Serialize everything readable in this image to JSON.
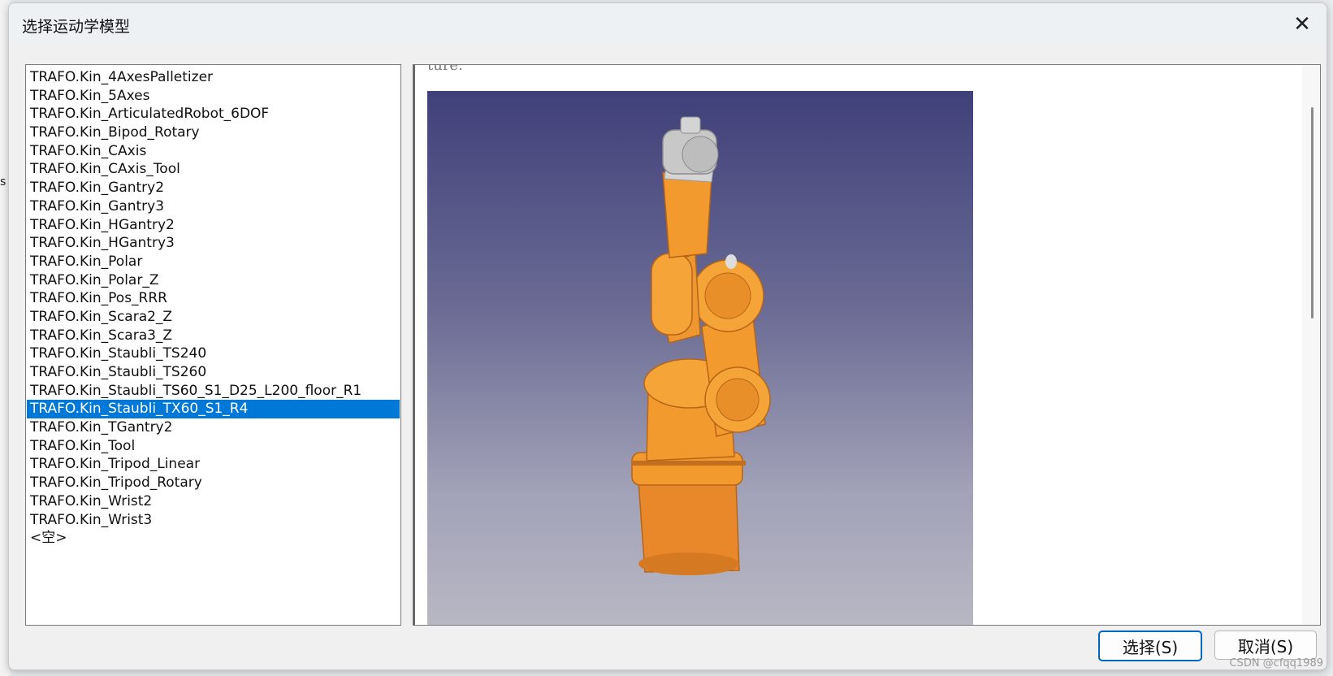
{
  "background": {
    "partial_text": "s"
  },
  "dialog": {
    "title": "选择运动学模型",
    "close_glyph": "✕",
    "list": {
      "items": [
        "TRAFO.Kin_4AxesPalletizer",
        "TRAFO.Kin_5Axes",
        "TRAFO.Kin_ArticulatedRobot_6DOF",
        "TRAFO.Kin_Bipod_Rotary",
        "TRAFO.Kin_CAxis",
        "TRAFO.Kin_CAxis_Tool",
        "TRAFO.Kin_Gantry2",
        "TRAFO.Kin_Gantry3",
        "TRAFO.Kin_HGantry2",
        "TRAFO.Kin_HGantry3",
        "TRAFO.Kin_Polar",
        "TRAFO.Kin_Polar_Z",
        "TRAFO.Kin_Pos_RRR",
        "TRAFO.Kin_Scara2_Z",
        "TRAFO.Kin_Scara3_Z",
        "TRAFO.Kin_Staubli_TS240",
        "TRAFO.Kin_Staubli_TS260",
        "TRAFO.Kin_Staubli_TS60_S1_D25_L200_floor_R1",
        "TRAFO.Kin_Staubli_TX60_S1_R4",
        "TRAFO.Kin_TGantry2",
        "TRAFO.Kin_Tool",
        "TRAFO.Kin_Tripod_Linear",
        "TRAFO.Kin_Tripod_Rotary",
        "TRAFO.Kin_Wrist2",
        "TRAFO.Kin_Wrist3",
        "<空>"
      ],
      "selected_index": 18
    },
    "preview": {
      "cut_text": "ture.",
      "robot_color": "#f29a2e",
      "background_top": "#40407a",
      "background_bottom": "#b8b8c4"
    },
    "buttons": {
      "ok": "选择(S)",
      "cancel": "取消(S)"
    }
  },
  "watermark": "CSDN @cfqq1989",
  "colors": {
    "selection": "#0078d7",
    "accent_border": "#0067c0"
  }
}
